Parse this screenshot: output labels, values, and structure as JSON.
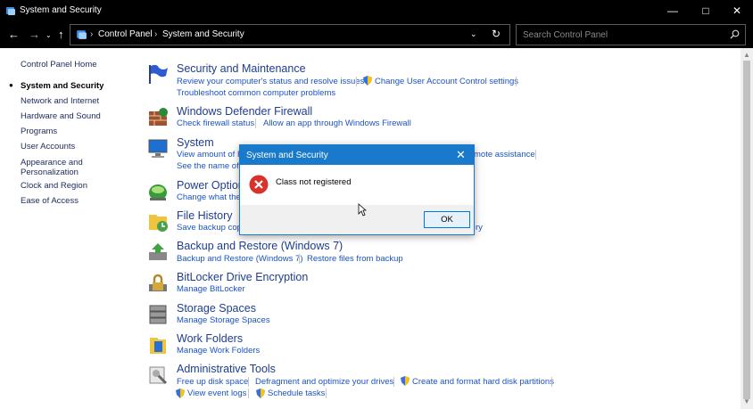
{
  "window": {
    "title": "System and Security"
  },
  "address": {
    "crumbs": [
      "Control Panel",
      "System and Security"
    ],
    "search_placeholder": "Search Control Panel"
  },
  "nav": {
    "items": [
      {
        "label": "Control Panel Home",
        "current": false
      },
      {
        "label": "System and Security",
        "current": true
      },
      {
        "label": "Network and Internet",
        "current": false
      },
      {
        "label": "Hardware and Sound",
        "current": false
      },
      {
        "label": "Programs",
        "current": false
      },
      {
        "label": "User Accounts",
        "current": false
      },
      {
        "label": "Appearance and",
        "current": false
      },
      {
        "label": "Personalization",
        "current": false
      },
      {
        "label": "Clock and Region",
        "current": false
      },
      {
        "label": "Ease of Access",
        "current": false
      }
    ]
  },
  "categories": [
    {
      "title": "Security and Maintenance",
      "links": [
        "Review your computer's status and resolve issues",
        "Change User Account Control settings",
        "Troubleshoot common computer problems"
      ]
    },
    {
      "title": "Windows Defender Firewall",
      "links": [
        "Check firewall status",
        "Allow an app through Windows Firewall"
      ]
    },
    {
      "title": "System",
      "links": [
        "View amount of R",
        "mote assistance",
        "See the name of th"
      ]
    },
    {
      "title": "Power Option",
      "links": [
        "Change what the"
      ]
    },
    {
      "title": "File History",
      "links": [
        "Save backup copi",
        "ry"
      ]
    },
    {
      "title": "Backup and Restore (Windows 7)",
      "links": [
        "Backup and Restore (Windows 7)",
        "Restore files from backup"
      ]
    },
    {
      "title": "BitLocker Drive Encryption",
      "links": [
        "Manage BitLocker"
      ]
    },
    {
      "title": "Storage Spaces",
      "links": [
        "Manage Storage Spaces"
      ]
    },
    {
      "title": "Work Folders",
      "links": [
        "Manage Work Folders"
      ]
    },
    {
      "title": "Administrative Tools",
      "links": [
        "Free up disk space",
        "Defragment and optimize your drives",
        "Create and format hard disk partitions",
        "View event logs",
        "Schedule tasks"
      ]
    }
  ],
  "dialog": {
    "title": "System and Security",
    "message": "Class not registered",
    "ok_label": "OK"
  },
  "colors": {
    "accent": "#1979ca",
    "link": "#1a53c4",
    "title_link": "#1e3d8f",
    "error": "#d9322b"
  }
}
